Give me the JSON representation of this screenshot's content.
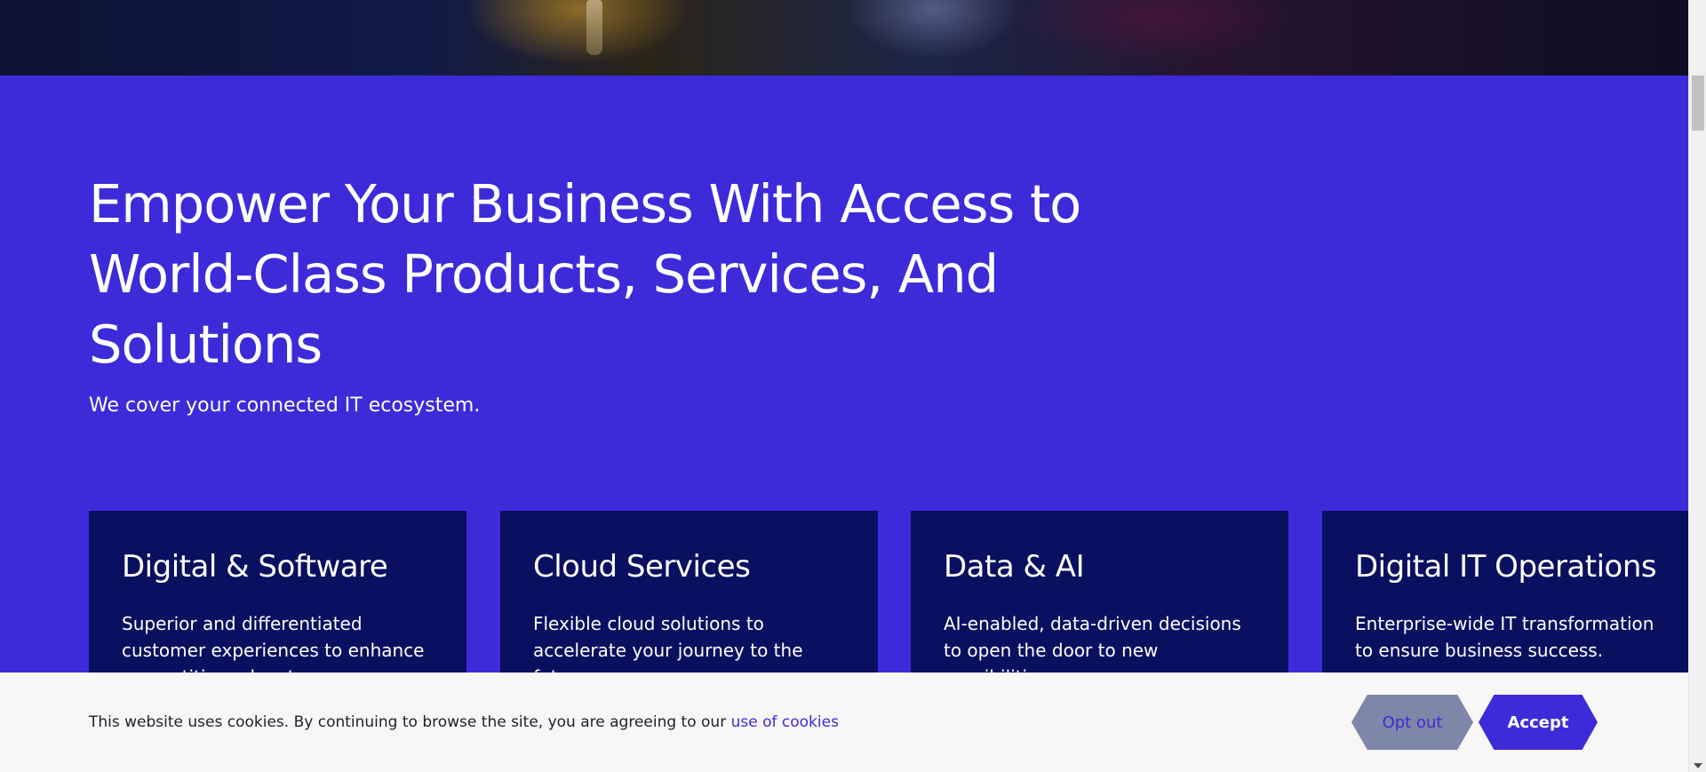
{
  "hero": {
    "headline": "Empower Your Business With Access to World-Class Products, Services, And Solutions",
    "subheadline": "We cover your connected IT ecosystem."
  },
  "cards": [
    {
      "title": "Digital & Software",
      "description": "Superior and differentiated customer experiences to enhance competitive advantage."
    },
    {
      "title": "Cloud Services",
      "description": "Flexible cloud solutions to accelerate your journey to the future."
    },
    {
      "title": "Data & AI",
      "description": "AI-enabled, data-driven decisions to open the door to new possibilities."
    },
    {
      "title": "Digital IT Operations",
      "description": "Enterprise-wide IT transformation to ensure business success."
    }
  ],
  "cookie_banner": {
    "text": "This website uses cookies. By continuing to browse the site, you are agreeing to our ",
    "link_label": "use of cookies",
    "opt_out_label": "Opt out",
    "accept_label": "Accept"
  },
  "colors": {
    "section_background": "#3d2bd9",
    "card_background": "#0a1060",
    "banner_background": "#f7f7f7",
    "opt_out_background": "#7f87a8",
    "accent": "#3d2bd9"
  }
}
